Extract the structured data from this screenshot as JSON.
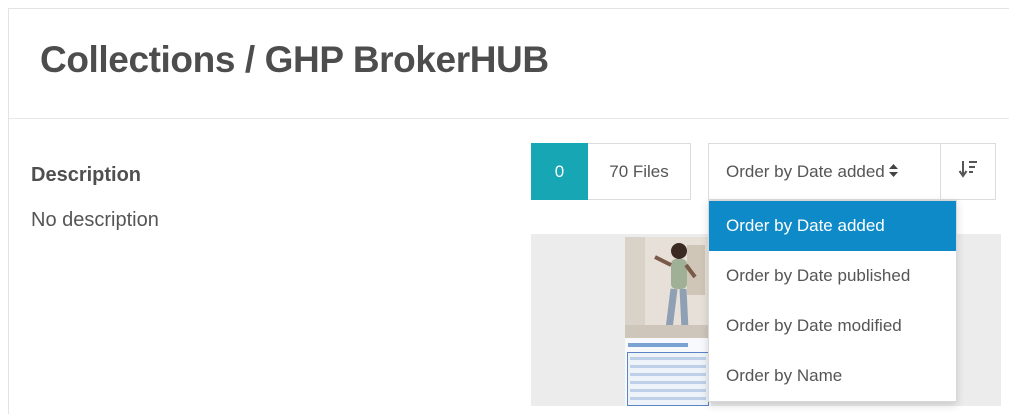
{
  "page": {
    "title": "Collections / GHP BrokerHUB"
  },
  "description": {
    "label": "Description",
    "text": "No description"
  },
  "toolbar": {
    "count": "0",
    "files_label": "70 Files",
    "order_selected": "Order by Date added",
    "sort_icon": "sort-descending-icon"
  },
  "order_options": [
    "Order by Date added",
    "Order by Date published",
    "Order by Date modified",
    "Order by Name"
  ],
  "colors": {
    "accent": "#17a7b4",
    "selected_option": "#0e8ac9"
  }
}
